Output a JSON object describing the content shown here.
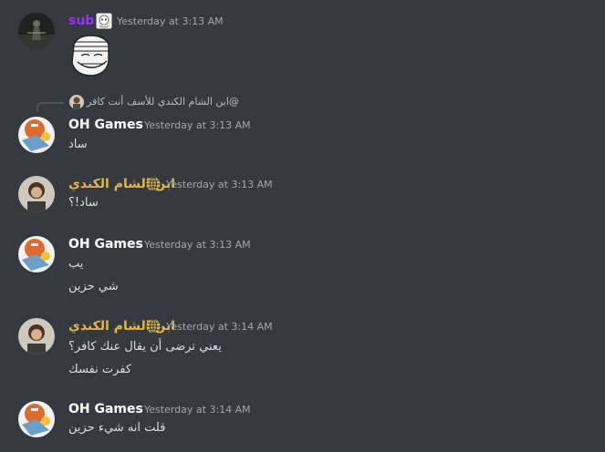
{
  "colors": {
    "background": "#36393f",
    "sub_name": "#9b30ff",
    "oh_games_name": "#ffffff",
    "arab_name": "#e0b84a",
    "timestamp": "#a3a6aa",
    "message_text": "#dcddde"
  },
  "messages": [
    {
      "author": "sub",
      "timestamp": "Yesterday at 3:13 AM",
      "badge_icon": "chibi-sticker-icon",
      "sticker": "troll-face-sticker"
    },
    {
      "reply": {
        "author": "ابن الشام الكندي",
        "text": "@ابن الشام الكندي للأسف أنت كافر"
      },
      "author": "OH Games",
      "timestamp": "Yesterday at 3:13 AM",
      "lines": [
        "ساد"
      ]
    },
    {
      "author": "ابن الشام الكندي",
      "timestamp": "Yesterday at 3:13 AM",
      "badge_icon": "globe-icon",
      "lines": [
        "ساد!؟"
      ]
    },
    {
      "author": "OH Games",
      "timestamp": "Yesterday at 3:13 AM",
      "lines": [
        "يب",
        "شي حزين"
      ]
    },
    {
      "author": "ابن الشام الكندي",
      "timestamp": "Yesterday at 3:14 AM",
      "badge_icon": "globe-icon",
      "lines": [
        "يعني ترضى أن يقال عنك كافر؟",
        "كفرت نفسك"
      ]
    },
    {
      "author": "OH Games",
      "timestamp": "Yesterday at 3:14 AM",
      "lines": [
        "قلت انه شيء حزين"
      ]
    }
  ]
}
